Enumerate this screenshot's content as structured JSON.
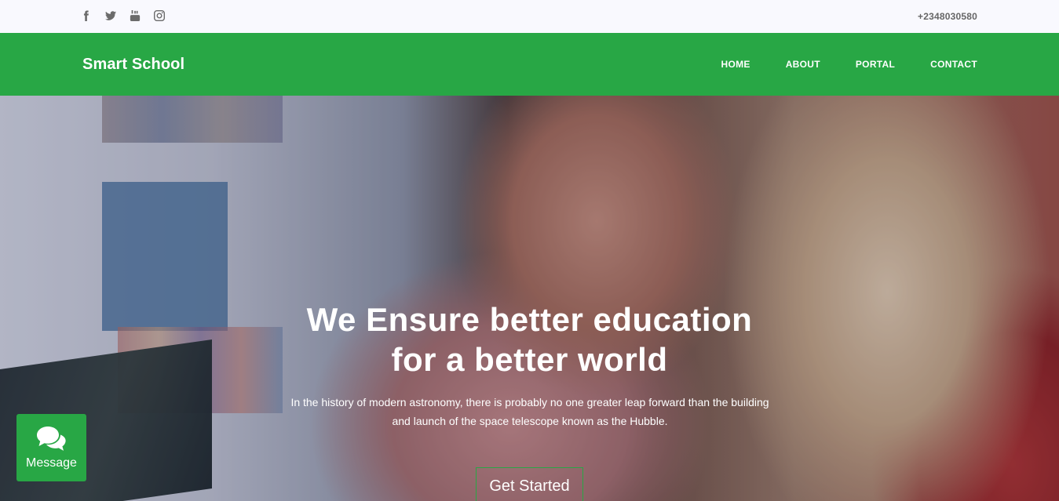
{
  "topbar": {
    "social_icons": [
      "facebook-icon",
      "twitter-icon",
      "youtube-icon",
      "instagram-icon"
    ],
    "phone": "+2348030580"
  },
  "navbar": {
    "brand": "Smart School",
    "menu": [
      "HOME",
      "ABOUT",
      "PORTAL",
      "CONTACT"
    ]
  },
  "hero": {
    "title_line1": "We Ensure better education",
    "title_line2": "for a better world",
    "text_line1": "In the history of modern astronomy, there is probably no one greater leap forward than the building",
    "text_line2": "and launch of the space telescope known as the Hubble.",
    "cta_label": "Get Started"
  },
  "message_widget": {
    "icon": "chat-bubbles-icon",
    "label": "Message"
  },
  "colors": {
    "accent": "#28a745",
    "topbar_bg": "#f9f9fe",
    "text_light": "#ffffff"
  }
}
